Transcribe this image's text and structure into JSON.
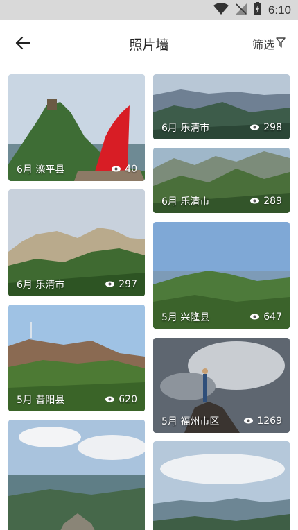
{
  "status_bar": {
    "time": "6:10"
  },
  "app_bar": {
    "title": "照片墙",
    "filter_label": "筛选"
  },
  "photos": [
    {
      "location": "6月 滦平县",
      "views": "40"
    },
    {
      "location": "6月 乐清市",
      "views": "298"
    },
    {
      "location": "6月 乐清市",
      "views": "289"
    },
    {
      "location": "6月 乐清市",
      "views": "297"
    },
    {
      "location": "5月 兴隆县",
      "views": "647"
    },
    {
      "location": "5月 昔阳县",
      "views": "620"
    },
    {
      "location": "5月 福州市区",
      "views": "1269"
    }
  ]
}
